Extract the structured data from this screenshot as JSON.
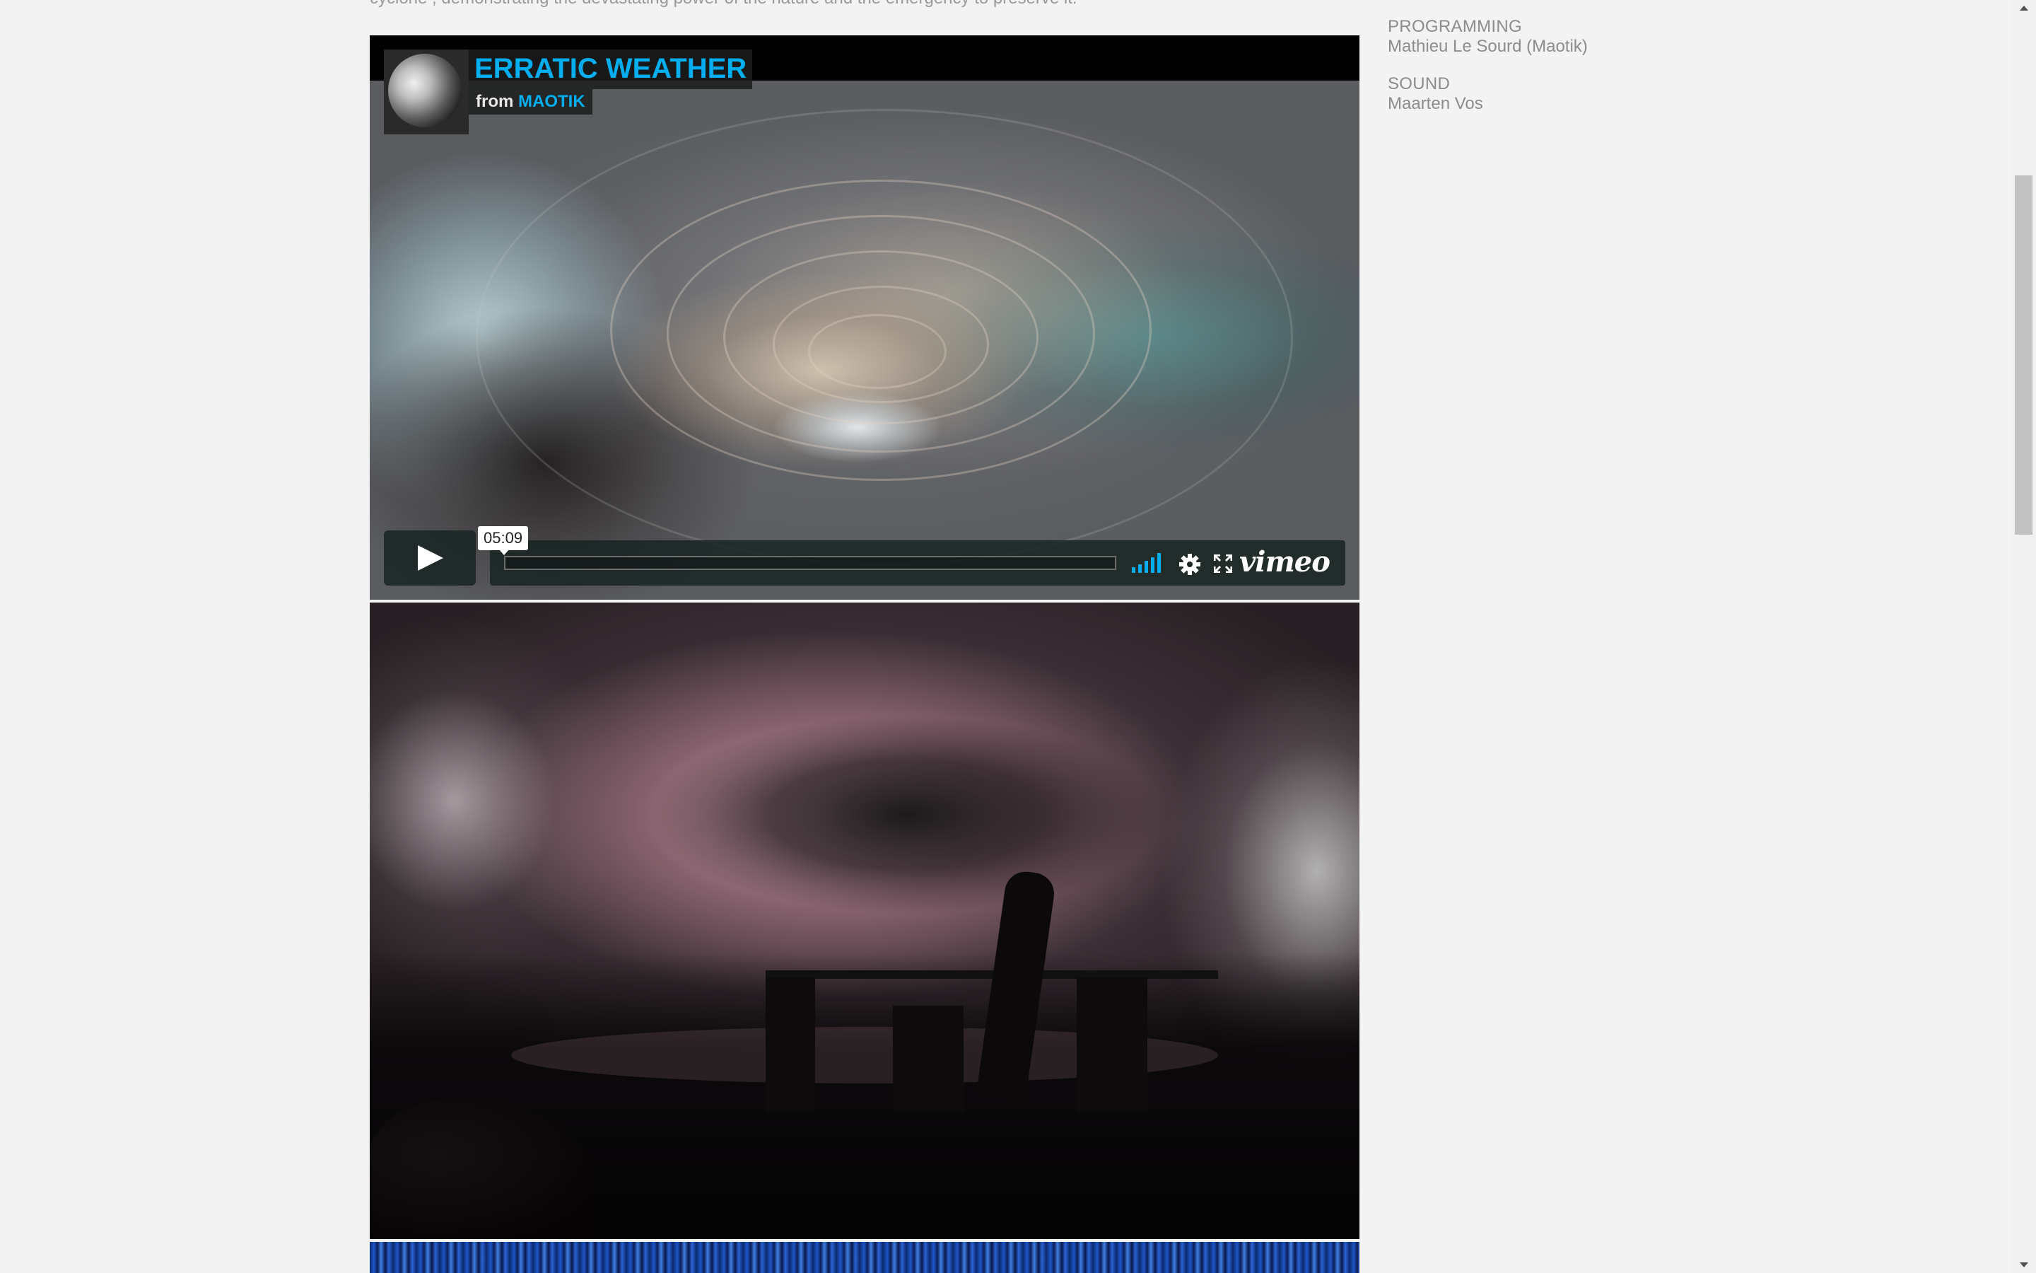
{
  "intro": {
    "text": "cyclone , demonstrating the devastating power of the nature and the emergency to preserve it."
  },
  "credits": [
    {
      "role": "PROGRAMMING",
      "name": "Mathieu Le Sourd (Maotik)"
    },
    {
      "role": "SOUND",
      "name": "Maarten Vos"
    }
  ],
  "video": {
    "title": "ERRATIC WEATHER",
    "byline_prefix": "from",
    "author": "MAOTIK",
    "duration": "05:09",
    "logo": "vimeo",
    "progress": 0,
    "icons": [
      "play-icon",
      "volume-icon",
      "settings-icon",
      "fullscreen-icon"
    ],
    "accent_color": "#00adef"
  },
  "images": [
    {
      "name": "performance-photo"
    },
    {
      "name": "blue-streaks-image"
    }
  ],
  "colors": {
    "background": "#f3f3f3",
    "text_muted": "#8c8c8c",
    "accent": "#00adef"
  }
}
